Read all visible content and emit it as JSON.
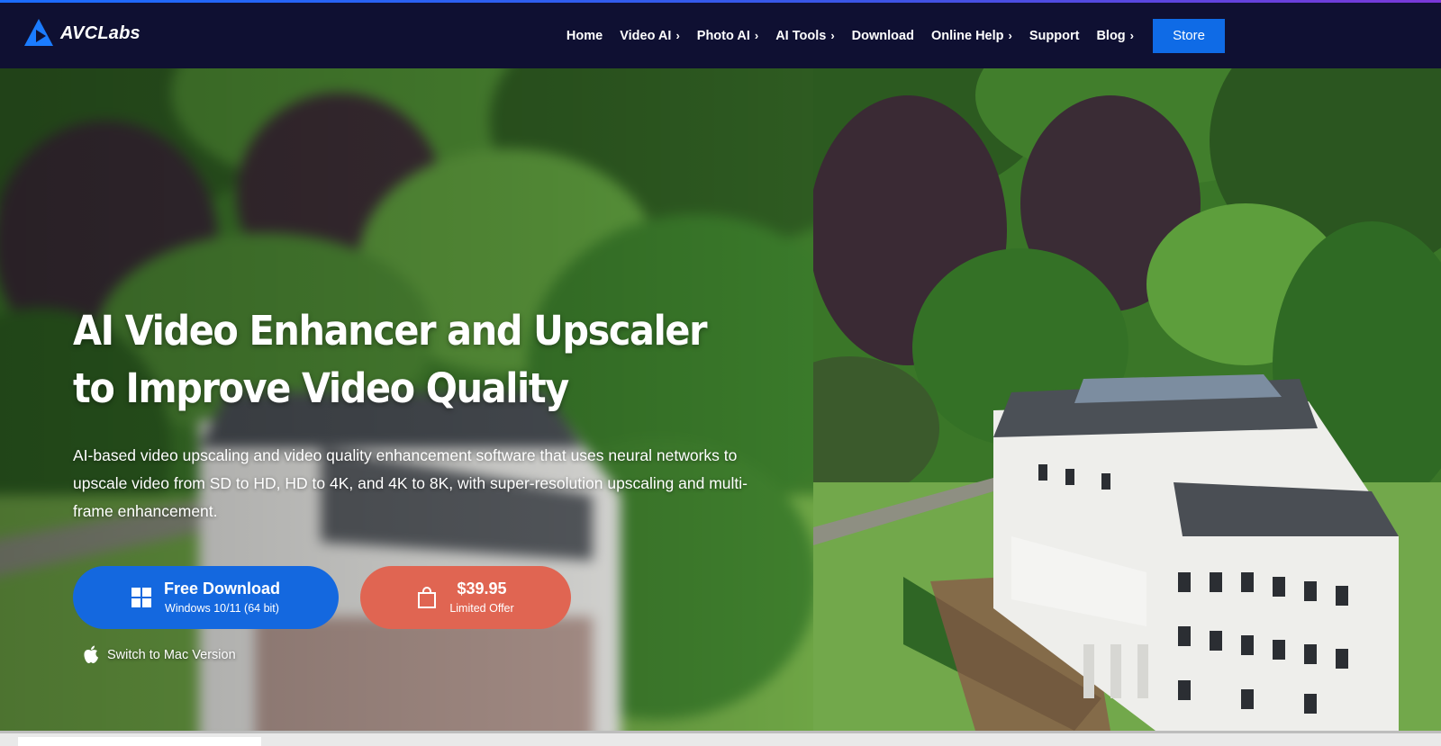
{
  "brand": {
    "name": "AVCLabs",
    "logo_icon": "avclabs-triangle-logo",
    "accent": "#1b7cff"
  },
  "nav": {
    "items": [
      {
        "label": "Home",
        "has_submenu": false
      },
      {
        "label": "Video AI",
        "has_submenu": true
      },
      {
        "label": "Photo AI",
        "has_submenu": true
      },
      {
        "label": "AI Tools",
        "has_submenu": true
      },
      {
        "label": "Download",
        "has_submenu": false
      },
      {
        "label": "Online Help",
        "has_submenu": true
      },
      {
        "label": "Support",
        "has_submenu": false
      },
      {
        "label": "Blog",
        "has_submenu": true
      }
    ],
    "chevron": "›",
    "store_label": "Store",
    "store_color": "#0f6be6"
  },
  "hero": {
    "title_line1": "AI Video Enhancer and Upscaler",
    "title_line2": "to Improve Video Quality",
    "description": "AI-based video upscaling and video quality enhancement software that uses neural networks to upscale video from SD to HD, HD to 4K, and 4K to 8K, with super-resolution upscaling and multi-frame enhancement.",
    "download_button": {
      "label": "Free Download",
      "sublabel": "Windows 10/11 (64 bit)",
      "icon": "windows-icon",
      "color": "#1468df"
    },
    "price_button": {
      "label": "$39.95",
      "sublabel": "Limited Offer",
      "icon": "shopping-bag-icon",
      "color": "#e06552"
    },
    "mac_link": {
      "label": "Switch to Mac Version",
      "icon": "apple-icon"
    }
  }
}
